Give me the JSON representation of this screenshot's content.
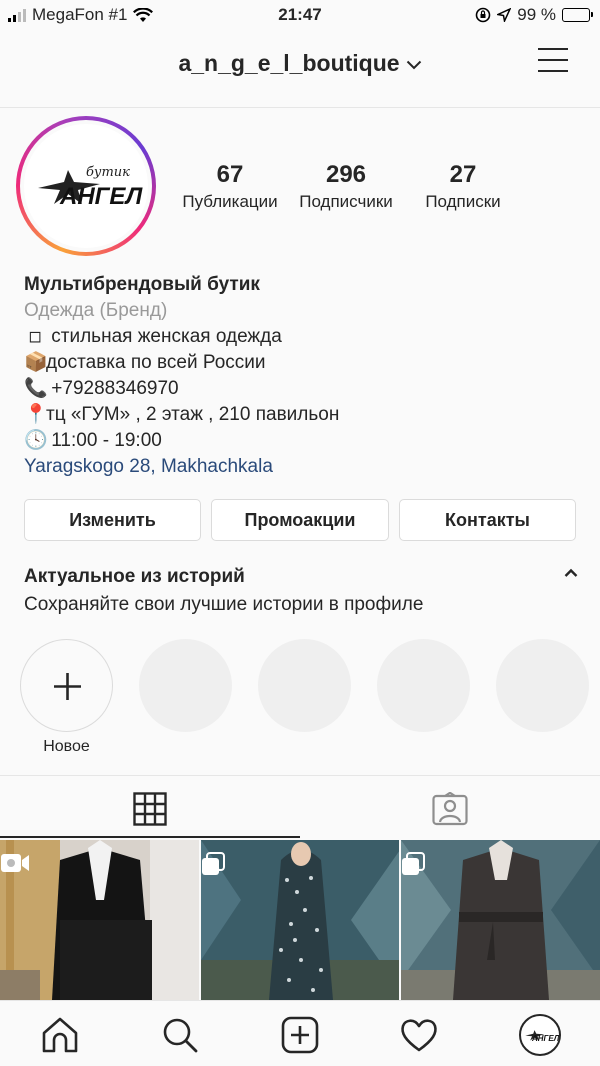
{
  "status_bar": {
    "carrier": "MegaFon #1",
    "time": "21:47",
    "battery": "99 %"
  },
  "header": {
    "username": "a_n_g_e_l_boutique"
  },
  "profile": {
    "avatar_text_script": "бутик",
    "avatar_text_main": "АНГЕЛ",
    "stats": [
      {
        "value": "67",
        "label": "Публикации"
      },
      {
        "value": "296",
        "label": "Подписчики"
      },
      {
        "value": "27",
        "label": "Подписки"
      }
    ],
    "bio": {
      "name": "Мультибрендовый бутик",
      "category": "Одежда (Бренд)",
      "lines": [
        {
          "emoji": "◽",
          "text": " стильная женская одежда"
        },
        {
          "emoji": "📦",
          "text": "доставка по всей России"
        },
        {
          "emoji": "📞",
          "text": " +79288346970"
        },
        {
          "emoji": "📍",
          "text": "тц «ГУМ» , 2 этаж , 210 павильон"
        },
        {
          "emoji": "🕓",
          "text": " 11:00 - 19:00"
        }
      ],
      "location": "Yaragskogo 28, Makhachkala"
    }
  },
  "actions": {
    "edit": "Изменить",
    "promotions": "Промоакции",
    "contacts": "Контакты"
  },
  "highlights": {
    "title": "Актуальное из историй",
    "subtitle": "Сохраняйте свои лучшие истории в профиле",
    "new_label": "Новое"
  },
  "icons": {
    "tab_grid": "grid-icon",
    "tab_tagged": "tagged-person-icon",
    "nav": [
      "home-icon",
      "search-icon",
      "new-post-icon",
      "activity-heart-icon",
      "profile-avatar-icon"
    ]
  }
}
